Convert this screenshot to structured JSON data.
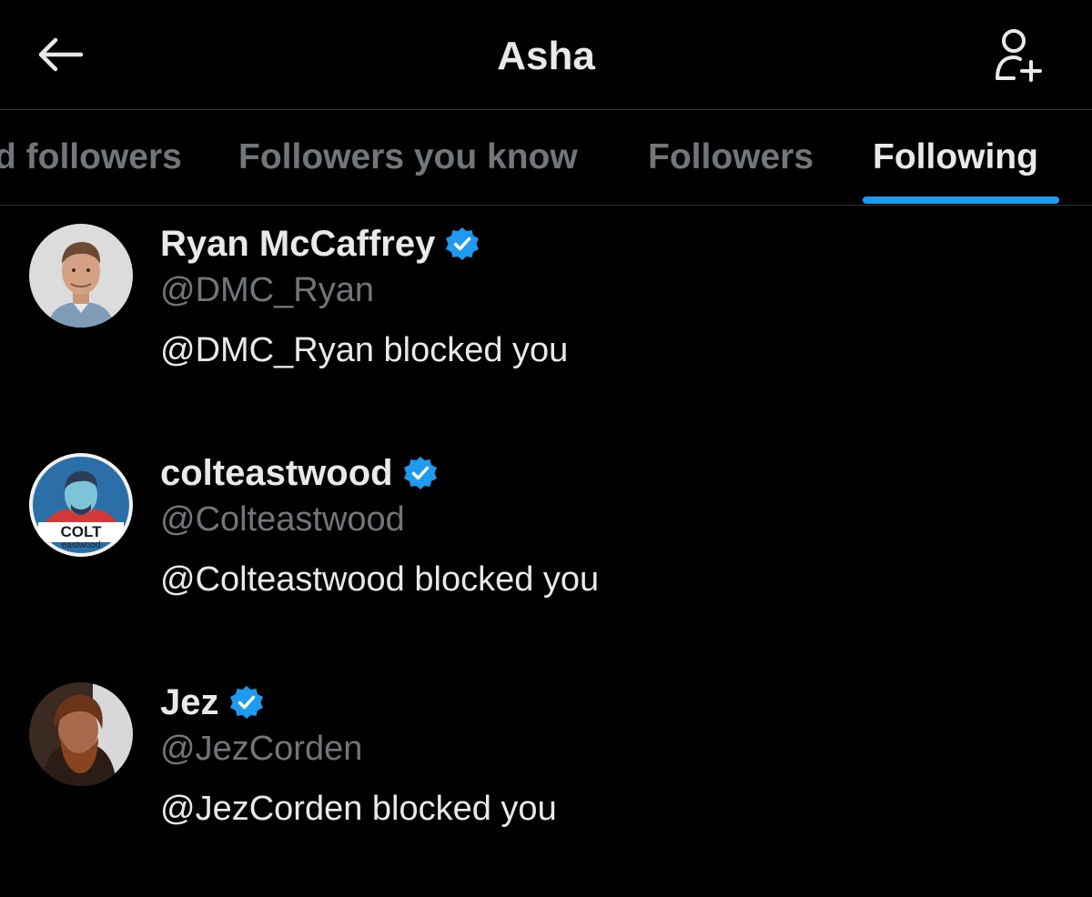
{
  "header": {
    "title": "Asha",
    "back_icon": "arrow-left-icon",
    "add_icon": "person-add-icon"
  },
  "tabs": [
    {
      "label": "d followers",
      "active": false
    },
    {
      "label": "Followers you know",
      "active": false
    },
    {
      "label": "Followers",
      "active": false
    },
    {
      "label": "Following",
      "active": true
    }
  ],
  "colors": {
    "background": "#000000",
    "accent": "#1d9bf0",
    "primary_text": "#e7e9ea",
    "secondary_text": "#71767b",
    "divider": "#2f3336"
  },
  "users": [
    {
      "name": "Ryan McCaffrey",
      "handle": "@DMC_Ryan",
      "bio": "@DMC_Ryan blocked you",
      "verified": true
    },
    {
      "name": "colteastwood",
      "handle": "@Colteastwood",
      "bio": "@Colteastwood blocked you",
      "verified": true,
      "avatar_text": {
        "top": "COLT",
        "bottom": "eastwood"
      }
    },
    {
      "name": "Jez",
      "handle": "@JezCorden",
      "bio": "@JezCorden blocked you",
      "verified": true
    }
  ]
}
